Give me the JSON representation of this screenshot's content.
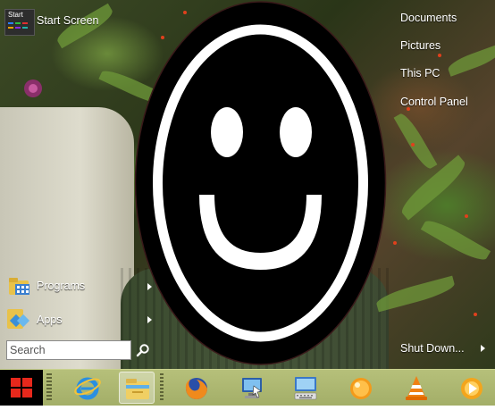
{
  "start_menu": {
    "start_tile_label": "Start",
    "start_screen": "Start Screen",
    "programs": "Programs",
    "apps": "Apps",
    "search_placeholder": "Search",
    "right_items": [
      "Documents",
      "Pictures",
      "This PC",
      "Control Panel"
    ],
    "shut_down": "Shut Down..."
  },
  "taskbar": {
    "pinned": [
      {
        "icon": "internet-explorer-icon"
      },
      {
        "icon": "file-explorer-icon",
        "active": true
      },
      {
        "icon": "firefox-icon"
      },
      {
        "icon": "remote-desktop-icon"
      },
      {
        "icon": "on-screen-keyboard-icon"
      },
      {
        "icon": "orange-app-icon"
      },
      {
        "icon": "vlc-icon"
      },
      {
        "icon": "media-player-icon"
      }
    ]
  },
  "colors": {
    "taskbar": "#a9b46d",
    "start_button": "#000000",
    "windows_logo": "#e8281c"
  }
}
